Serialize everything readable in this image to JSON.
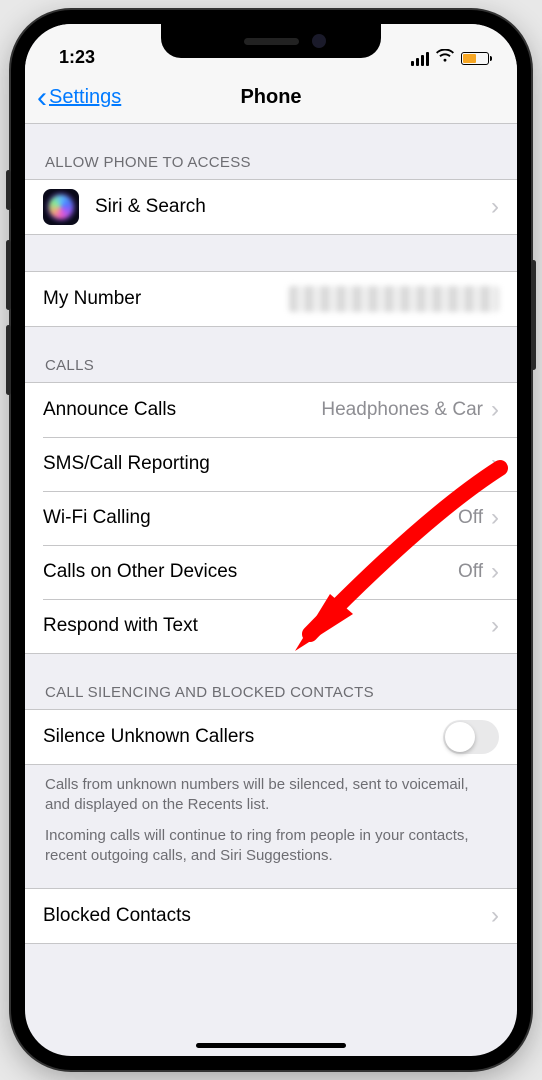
{
  "status": {
    "time": "1:23"
  },
  "nav": {
    "back_label": "Settings",
    "title": "Phone"
  },
  "sections": {
    "access": {
      "header": "ALLOW PHONE TO ACCESS",
      "siri_label": "Siri & Search"
    },
    "my_number": {
      "label": "My Number"
    },
    "calls": {
      "header": "CALLS",
      "announce_label": "Announce Calls",
      "announce_value": "Headphones & Car",
      "sms_report_label": "SMS/Call Reporting",
      "wifi_calling_label": "Wi-Fi Calling",
      "wifi_calling_value": "Off",
      "other_devices_label": "Calls on Other Devices",
      "other_devices_value": "Off",
      "respond_label": "Respond with Text"
    },
    "silencing": {
      "header": "CALL SILENCING AND BLOCKED CONTACTS",
      "silence_unknown_label": "Silence Unknown Callers",
      "footer1": "Calls from unknown numbers will be silenced, sent to voicemail, and displayed on the Recents list.",
      "footer2": "Incoming calls will continue to ring from people in your contacts, recent outgoing calls, and Siri Suggestions.",
      "blocked_label": "Blocked Contacts"
    }
  }
}
